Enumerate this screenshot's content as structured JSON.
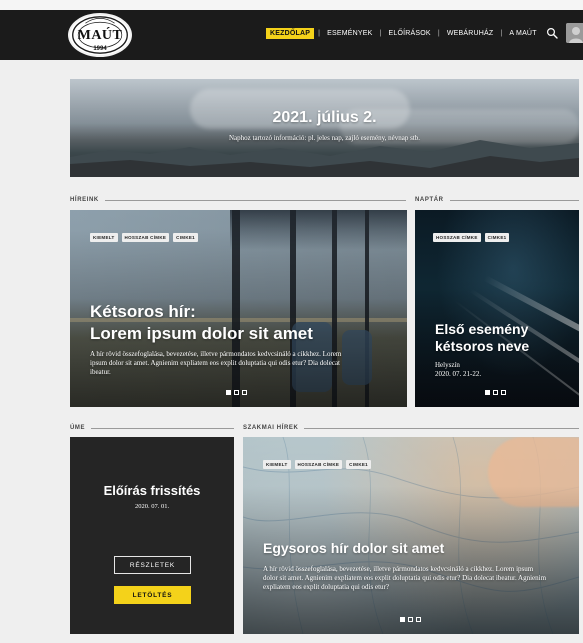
{
  "header": {
    "logo_text": "MAÚT",
    "logo_year": "1994",
    "nav": [
      {
        "label": "KEZDŐLAP",
        "active": true
      },
      {
        "label": "ESEMÉNYEK",
        "active": false
      },
      {
        "label": "ELŐÍRÁSOK",
        "active": false
      },
      {
        "label": "WEBÁRUHÁZ",
        "active": false
      },
      {
        "label": "A MAÚT",
        "active": false
      }
    ],
    "search_icon": "search-icon",
    "avatar_icon": "user-avatar"
  },
  "hero": {
    "title": "2021. július 2.",
    "subtitle": "Naphoz tartozó információ: pl. jeles nap, zajló esemény, névnap stb."
  },
  "sections": {
    "news_label": "HÍREINK",
    "calendar_label": "NAPTÁR",
    "ume_label": "ÚME",
    "professional_label": "SZAKMAI HÍREK"
  },
  "news_card": {
    "tags": [
      "KIEMELT",
      "HOSSZAB CÍMKE",
      "CIMKE1"
    ],
    "title_line1": "Kétsoros hír:",
    "title_line2": "Lorem ipsum dolor sit amet",
    "summary": "A hír rövid összefoglalása, bevezetése, illetve pármondatos kedvcsináló a cikkhez. Lorem ipsum dolor sit amet. Agnienim expliatem eos explit doluptatia qui odis etur? Dia dolecat ibeatur.",
    "dots": [
      true,
      false,
      false
    ]
  },
  "calendar_card": {
    "tags": [
      "HOSSZAB CÍMKE",
      "CIMKE1"
    ],
    "title_line1": "Első esemény",
    "title_line2": "kétsoros neve",
    "location": "Helyszín",
    "datetime": "2020. 07. 21-22.",
    "dots": [
      true,
      false,
      false
    ]
  },
  "ume_card": {
    "title": "Előírás frissítés",
    "date": "2020. 07. 01.",
    "details_button": "RÉSZLETEK",
    "download_button": "LETÖLTÉS"
  },
  "professional_card": {
    "tags": [
      "KIEMELT",
      "HOSSZAB CÍMKE",
      "CIMKE1"
    ],
    "title": "Egysoros hír dolor sit amet",
    "summary": "A hír rövid összefoglalása, bevezetése, illetve pármondatos kedvcsináló a cikkhez. Lorem ipsum dolor sit amet. Agnienim expliatem eos explit doluptatia qui odis etur? Dia dolecat ibeatur. Agnienim expliatem eos explit doluptatia qui odis etur?",
    "dots": [
      true,
      false,
      false
    ]
  },
  "colors": {
    "accent": "#f4d21a",
    "header_bg": "#1b1b1b",
    "page_bg": "#efefef",
    "ume_bg": "#252525"
  }
}
